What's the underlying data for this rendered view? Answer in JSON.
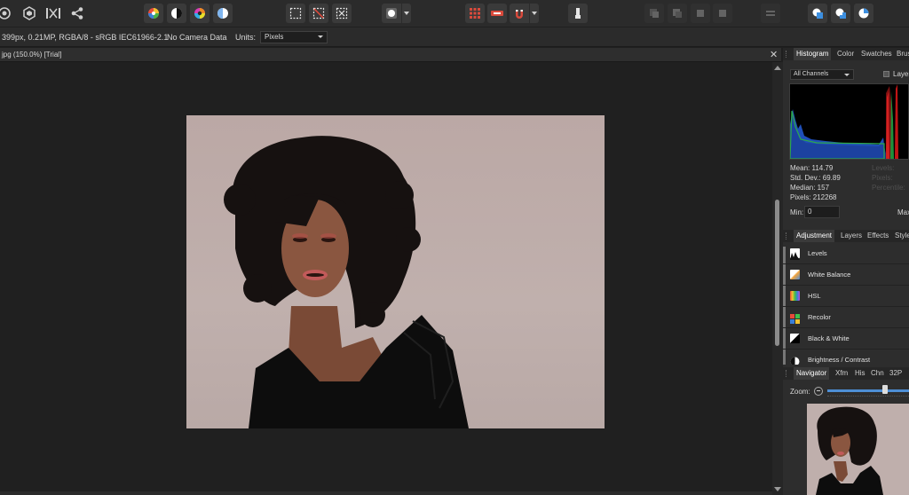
{
  "toolbar": {
    "buttons": [
      {
        "name": "personas-develop-icon"
      },
      {
        "name": "persona-photo-icon"
      },
      {
        "name": "persona-export-icon"
      },
      {
        "name": "share-icon"
      },
      {
        "name": "color-wheel-icon"
      },
      {
        "name": "contrast-icon"
      },
      {
        "name": "hsl-wheel-icon"
      },
      {
        "name": "white-balance-icon"
      },
      {
        "name": "marquee-select-icon"
      },
      {
        "name": "deselect-icon"
      },
      {
        "name": "invert-selection-icon"
      },
      {
        "name": "quick-mask-icon"
      },
      {
        "name": "grid-snapping-icon"
      },
      {
        "name": "assistant-icon"
      },
      {
        "name": "snapping-magnet-icon"
      },
      {
        "name": "brush-tool-icon"
      },
      {
        "name": "arrange-back-icon"
      },
      {
        "name": "arrange-backward-icon"
      },
      {
        "name": "arrange-forward-icon"
      },
      {
        "name": "arrange-front-icon"
      },
      {
        "name": "align-icon"
      },
      {
        "name": "boolean-add-icon"
      },
      {
        "name": "boolean-subtract-icon"
      },
      {
        "name": "boolean-intersect-icon"
      }
    ]
  },
  "context": {
    "image_info": "399px, 0.21MP, RGBA/8 - sRGB IEC61966-2.1",
    "camera": "No Camera Data",
    "units_label": "Units:",
    "units_value": "Pixels"
  },
  "document": {
    "tab_title": "jpg (150.0%) [Trial]",
    "close": "✕"
  },
  "histogram_panel": {
    "tabs": [
      "Histogram",
      "Color",
      "Swatches",
      "Brus"
    ],
    "channel": "All Channels",
    "layer_label": "Layer",
    "stats": [
      {
        "label": "Mean: 114.79"
      },
      {
        "label": "Std. Dev.: 69.89"
      },
      {
        "label": "Median: 157"
      },
      {
        "label": "Pixels: 212268"
      }
    ],
    "faded_stats": [
      "Levels:",
      "Pixels:",
      "Percentile:"
    ],
    "min_label": "Min:",
    "min_value": "0",
    "max_label": "Max"
  },
  "adjustment_panel": {
    "tabs": [
      "Adjustment",
      "Layers",
      "Effects",
      "Styles"
    ],
    "items": [
      {
        "label": "Levels",
        "icon": "levels-icon"
      },
      {
        "label": "White Balance",
        "icon": "white-balance-icon"
      },
      {
        "label": "HSL",
        "icon": "hsl-icon"
      },
      {
        "label": "Recolor",
        "icon": "recolor-icon"
      },
      {
        "label": "Black & White",
        "icon": "black-white-icon"
      },
      {
        "label": "Brightness / Contrast",
        "icon": "brightness-contrast-icon"
      }
    ]
  },
  "navigator_panel": {
    "tabs": [
      "Navigator",
      "Xfm",
      "His",
      "Chn",
      "32P"
    ],
    "zoom_label": "Zoom:"
  },
  "colors": {
    "accent": "#4d8fd6",
    "panel_bg": "#2d2d2d",
    "canvas_bg": "#202020"
  }
}
